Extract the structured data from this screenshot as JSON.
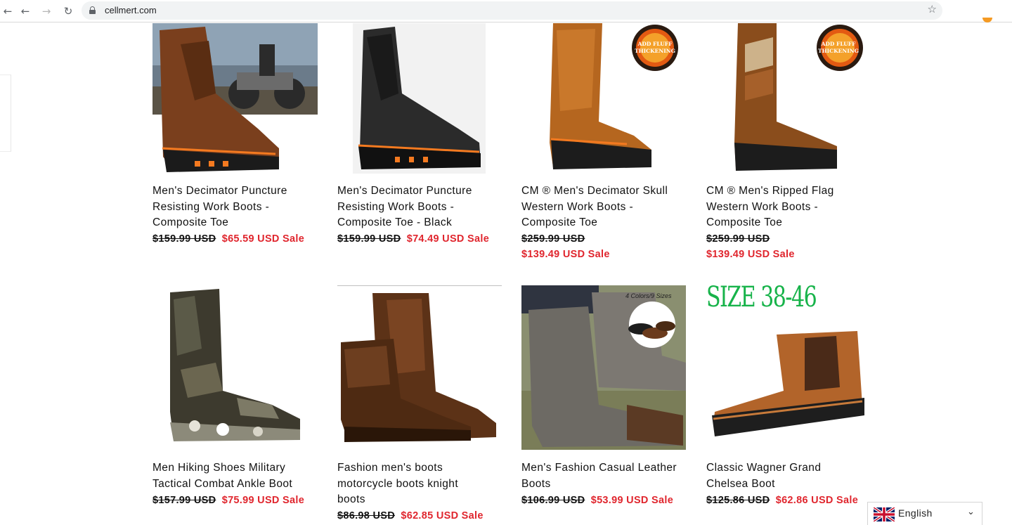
{
  "browser": {
    "url": "cellmert.com",
    "icons": [
      "back-icon",
      "forward-icon",
      "reload-icon",
      "lock-icon",
      "star-icon"
    ]
  },
  "colors": {
    "sale": "#e0262e",
    "text": "#111111",
    "accent_boot_orange": "#f47a20"
  },
  "products": [
    {
      "title_lines": [
        "Men's Decimator Puncture",
        "Resisting Work Boots -",
        "Composite Toe"
      ],
      "old_price": "$159.99 USD",
      "sale_price": "$65.59 USD Sale"
    },
    {
      "title_lines": [
        "Men's Decimator Puncture",
        "Resisting Work Boots -",
        "Composite Toe - Black"
      ],
      "old_price": "$159.99 USD",
      "sale_price": "$74.49 USD Sale"
    },
    {
      "title_lines": [
        "CM ® Men's Decimator Skull",
        "Western Work Boots -",
        "Composite Toe"
      ],
      "old_price": "$259.99 USD",
      "sale_price": "$139.49 USD Sale",
      "badge": [
        "ADD FLUFF",
        "THICKENING"
      ]
    },
    {
      "title_lines": [
        "CM ® Men's Ripped Flag",
        "Western Work Boots -",
        "Composite Toe"
      ],
      "old_price": "$259.99 USD",
      "sale_price": "$139.49 USD Sale",
      "badge": [
        "ADD FLUFF",
        "THICKENING"
      ]
    },
    {
      "title_lines": [
        "Men Hiking Shoes Military",
        "Tactical Combat Ankle Boot"
      ],
      "old_price": "$157.99 USD",
      "sale_price": "$75.99 USD Sale"
    },
    {
      "title_lines": [
        "Fashion men's boots",
        "motorcycle boots knight",
        "boots"
      ],
      "old_price": "$86.98 USD",
      "sale_price": "$62.85 USD Sale"
    },
    {
      "title_lines": [
        "Men's Fashion Casual Leather",
        "Boots"
      ],
      "old_price": "$106.99 USD",
      "sale_price": "$53.99 USD Sale",
      "overlay": "4 Colors/9 Sizes"
    },
    {
      "title_lines": [
        "Classic Wagner Grand",
        "Chelsea Boot"
      ],
      "old_price": "$125.86 USD",
      "sale_price": "$62.86 USD Sale",
      "overlay": "SIZE 38-46"
    }
  ],
  "language_selector": {
    "label": "English",
    "flag": "uk-flag-icon"
  }
}
